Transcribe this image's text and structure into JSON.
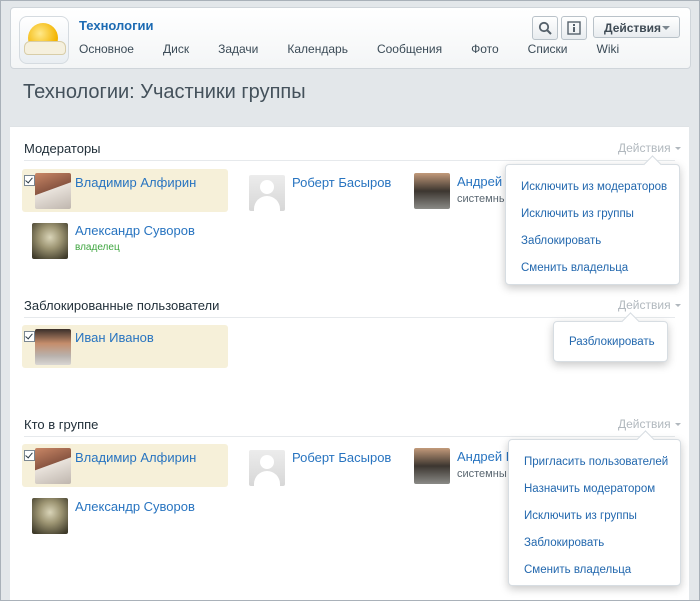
{
  "header": {
    "group_title": "Технологии",
    "nav": [
      "Основное",
      "Диск",
      "Задачи",
      "Календарь",
      "Сообщения",
      "Фото",
      "Списки",
      "Wiki"
    ],
    "actions_label": "Действия"
  },
  "page_title": "Технологии: Участники группы",
  "sections": {
    "moderators": {
      "title": "Модераторы",
      "actions_label": "Действия",
      "members": [
        {
          "name": "Владимир Алфирин",
          "subtitle": "",
          "selected": true,
          "avatar": "photo-man-1"
        },
        {
          "name": "Роберт Басыров",
          "subtitle": "",
          "selected": false,
          "avatar": "placeholder"
        },
        {
          "name": "Андрей Г",
          "subtitle": "системны",
          "selected": false,
          "avatar": "photo-man-2"
        },
        {
          "name": "Александр Суворов",
          "subtitle": "владелец",
          "selected": false,
          "avatar": "portrait-suvorov"
        }
      ],
      "menu": [
        "Исключить из модераторов",
        "Исключить из группы",
        "Заблокировать",
        "Сменить владельца"
      ]
    },
    "blocked": {
      "title": "Заблокированные пользователи",
      "actions_label": "Действия",
      "members": [
        {
          "name": "Иван Иванов",
          "subtitle": "",
          "selected": true,
          "avatar": "photo-man-3"
        }
      ],
      "menu": [
        "Разблокировать"
      ]
    },
    "members": {
      "title": "Кто в группе",
      "actions_label": "Действия",
      "members": [
        {
          "name": "Владимир Алфирин",
          "subtitle": "",
          "selected": true,
          "avatar": "photo-man-1"
        },
        {
          "name": "Роберт Басыров",
          "subtitle": "",
          "selected": false,
          "avatar": "placeholder"
        },
        {
          "name": "Андрей Г",
          "subtitle": "системны",
          "selected": false,
          "avatar": "photo-man-2"
        },
        {
          "name": "Александр Суворов",
          "subtitle": "",
          "selected": false,
          "avatar": "portrait-suvorov"
        }
      ],
      "menu": [
        "Пригласить пользователей",
        "Назначить модератором",
        "Исключить из группы",
        "Заблокировать",
        "Сменить владельца"
      ]
    }
  },
  "icons": [
    "search-icon",
    "info-icon",
    "caret-down-icon",
    "checkbox-icon"
  ],
  "colors": {
    "link": "#2874c0",
    "owner": "#3ea53f",
    "selected_bg": "#f6f0d9",
    "muted": "#b1b8be"
  }
}
